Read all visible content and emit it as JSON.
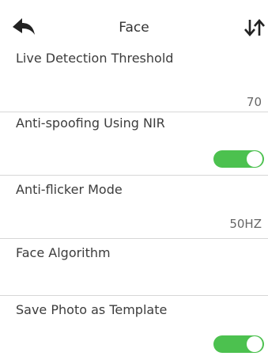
{
  "header": {
    "title": "Face",
    "back_icon": "back-arrow-icon",
    "sort_icon": "sort-icon"
  },
  "settings": [
    {
      "label": "Live Detection Threshold",
      "value": "70"
    },
    {
      "label": "Anti-spoofing Using NIR",
      "toggle": true
    },
    {
      "label": "Anti-flicker Mode",
      "value": "50HZ"
    },
    {
      "label": "Face Algorithm"
    },
    {
      "label": "Save Photo as Template",
      "toggle": true
    }
  ],
  "colors": {
    "toggle_on": "#4cc14f",
    "divider": "#d7d7d7",
    "background": "#ffffff"
  }
}
